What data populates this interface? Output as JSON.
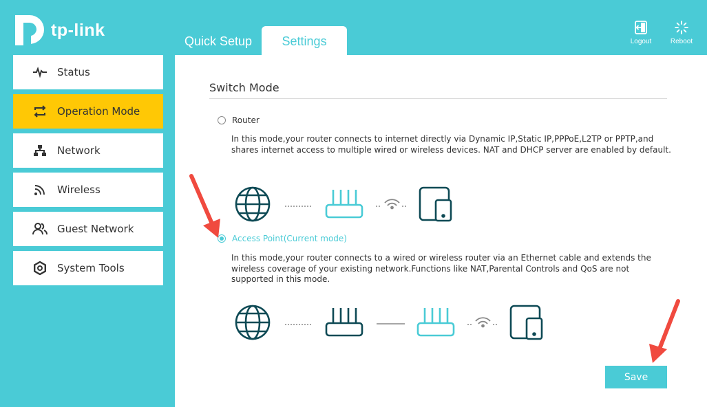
{
  "brand": {
    "name": "tp-link"
  },
  "tabs": [
    {
      "label": "Quick Setup",
      "active": false
    },
    {
      "label": "Settings",
      "active": true
    }
  ],
  "top_actions": {
    "logout": "Logout",
    "reboot": "Reboot"
  },
  "sidebar": {
    "items": [
      {
        "label": "Status",
        "icon": "pulse-icon",
        "active": false
      },
      {
        "label": "Operation Mode",
        "icon": "switch-arrows-icon",
        "active": true
      },
      {
        "label": "Network",
        "icon": "network-icon",
        "active": false
      },
      {
        "label": "Wireless",
        "icon": "wireless-icon",
        "active": false
      },
      {
        "label": "Guest Network",
        "icon": "guests-icon",
        "active": false
      },
      {
        "label": "System Tools",
        "icon": "gear-icon",
        "active": false
      }
    ]
  },
  "main": {
    "title": "Switch Mode",
    "modes": [
      {
        "label": "Router",
        "selected": false,
        "description": "In this mode,your router connects to internet directly via Dynamic IP,Static IP,PPPoE,L2TP or PPTP,and shares internet access to multiple wired or wireless devices. NAT and DHCP server are enabled by default."
      },
      {
        "label": "Access Point(Current mode)",
        "selected": true,
        "description": "In this mode,your router connects to a wired or wireless router via an Ethernet cable and extends the wireless coverage of your existing network.Functions like NAT,Parental Controls and QoS are not supported in this mode."
      }
    ],
    "save_label": "Save"
  },
  "colors": {
    "accent": "#4acbd6",
    "active_nav": "#ffc805",
    "icon_dark": "#0e4a55",
    "annotation_arrow": "#f04a3f"
  }
}
